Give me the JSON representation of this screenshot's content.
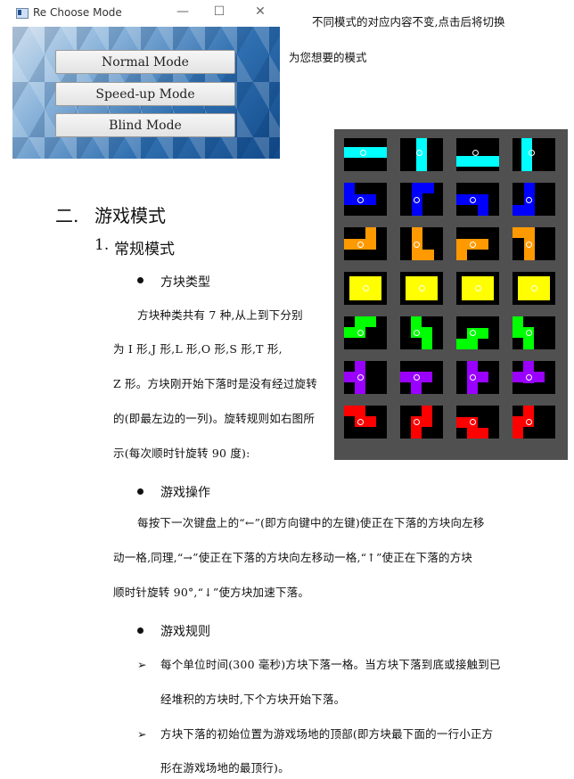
{
  "window": {
    "title": "Re Choose Mode",
    "buttons": [
      "Normal Mode",
      "Speed-up Mode",
      "Blind Mode"
    ],
    "min_glyph": "—",
    "max_glyph": "☐",
    "close_glyph": "✕"
  },
  "note": {
    "line1": "不同模式的对应内容不变,点击后将切换",
    "line2": "为您想要的模式"
  },
  "section": {
    "number": "二.",
    "title": "游戏模式",
    "sub_number": "1.",
    "sub_title": "常规模式"
  },
  "block_types": {
    "heading": "方块类型",
    "lines": [
      "方块种类共有 7 种,从上到下分别",
      "为 I 形,J 形,L 形,O 形,S 形,T 形,",
      "Z 形。方块刚开始下落时是没有经过旋转",
      "的(即最左边的一列)。旋转规则如右图所",
      "示(每次顺时针旋转 90 度):"
    ]
  },
  "operation": {
    "heading": "游戏操作",
    "lines": [
      "每按下一次键盘上的“←”(即方向键中的左键)使正在下落的方块向左移",
      "动一格,同理,“→”使正在下落的方块向左移动一格,“↑”使正在下落的方块",
      "顺时针旋转 90°,“↓”使方块加速下落。"
    ]
  },
  "rules": {
    "heading": "游戏规则",
    "marker": "➢",
    "items": [
      {
        "line1": "每个单位时间(300 毫秒)方块下落一格。当方块下落到底或接触到已",
        "line2": "经堆积的方块时,下个方块开始下落。"
      },
      {
        "line1": "方块下落的初始位置为游戏场地的顶部(即方块最下面的一行小正方",
        "line2": "形在游戏场地的最顶行)。"
      }
    ]
  },
  "figure": {
    "colors": [
      "#00ffff",
      "#0000ff",
      "#ff9900",
      "#ffff00",
      "#00ff00",
      "#9900ff",
      "#ff0000"
    ],
    "background": "#505050"
  }
}
